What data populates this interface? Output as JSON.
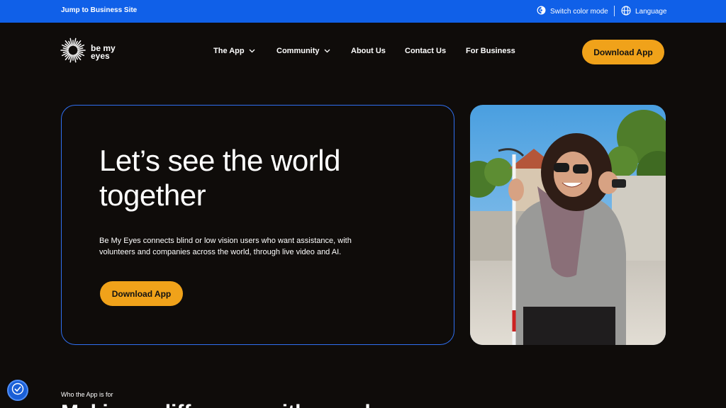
{
  "topbar": {
    "jump_link": "Jump to Business Site",
    "color_mode": "Switch color mode",
    "language": "Language",
    "icons": [
      "color-mode-icon",
      "globe-icon"
    ]
  },
  "logo": {
    "line1": "be my",
    "line2": "eyes"
  },
  "nav": {
    "items": [
      {
        "label": "The App",
        "dropdown": true
      },
      {
        "label": "Community",
        "dropdown": true
      },
      {
        "label": "About Us",
        "dropdown": false
      },
      {
        "label": "Contact Us",
        "dropdown": false
      },
      {
        "label": "For Business",
        "dropdown": false
      }
    ],
    "cta": "Download App"
  },
  "hero": {
    "title": "Let’s see the world together",
    "description": "Be My Eyes connects blind or low vision users who want assistance, with volunteers and companies across the world, through live video and AI.",
    "cta": "Download App"
  },
  "section": {
    "kicker": "Who the App is for",
    "heading": "Making a difference with people"
  },
  "colors": {
    "topbar": "#1060e8",
    "background": "#0f0c0a",
    "accent": "#f0a21a",
    "card_border": "#2f6ff0"
  }
}
